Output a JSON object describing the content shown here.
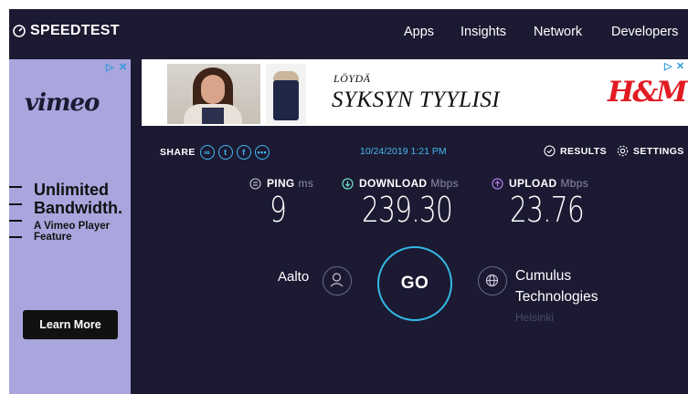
{
  "header": {
    "logo": "SPEEDTEST",
    "nav": [
      "Apps",
      "Insights",
      "Network",
      "Developers"
    ]
  },
  "left_ad": {
    "brand": "vimeo",
    "headline": "Unlimited Bandwidth.",
    "subtext": "A Vimeo Player Feature",
    "cta": "Learn More"
  },
  "top_ad": {
    "small_line": "LÖYDÄ",
    "big_line": "SYKSYN TYYLISI",
    "brand_logo": "H&M"
  },
  "toolbar": {
    "share_label": "SHARE",
    "datetime": "10/24/2019 1:21 PM",
    "results_label": "RESULTS",
    "settings_label": "SETTINGS"
  },
  "metrics": {
    "ping": {
      "label": "PING",
      "unit": "ms",
      "value": "9"
    },
    "download": {
      "label": "DOWNLOAD",
      "unit": "Mbps",
      "value": "239.30"
    },
    "upload": {
      "label": "UPLOAD",
      "unit": "Mbps",
      "value": "23.76"
    }
  },
  "test": {
    "isp": "Aalto",
    "go_label": "GO",
    "server_name": "Cumulus Technologies",
    "server_location": "Helsinki"
  },
  "colors": {
    "background": "#1b1a32",
    "accent": "#46b8ef",
    "upload_accent": "#b07ce8",
    "download_accent": "#6fe0c8"
  }
}
